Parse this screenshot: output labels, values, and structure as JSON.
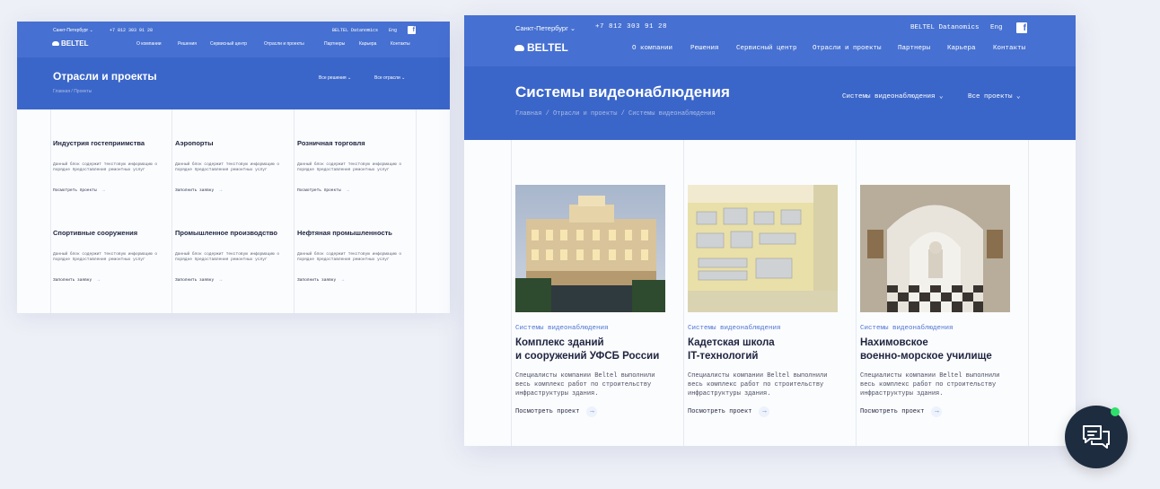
{
  "left_mockup": {
    "header": {
      "city": "Санкт-Петербург ⌄",
      "phone": "+7 812 303 91 28",
      "datanomics": "BELTEL Datanomics",
      "lang": "Eng",
      "fb_icon": "f",
      "logo": "BELTEL",
      "nav": [
        "О компании",
        "Решения",
        "Сервисный центр",
        "Отрасли и проекты",
        "Партнеры",
        "Карьера",
        "Контакты"
      ]
    },
    "hero": {
      "title": "Отрасли и проекты",
      "breadcrumb": "Главная / Проекты",
      "filter_solutions": "Все решения ⌄",
      "filter_industries": "Все отрасли ⌄"
    },
    "cards": [
      {
        "title": "Индустрия гостеприимства",
        "desc": "Данный блок содержит текстовую информацию о порядке предоставления ремонтных услуг",
        "link": "Посмотреть проекты"
      },
      {
        "title": "Аэропорты",
        "desc": "Данный блок содержит текстовую информацию о порядке предоставления ремонтных услуг",
        "link": "Заполнить заявку"
      },
      {
        "title": "Розничная торговля",
        "desc": "Данный блок содержит текстовую информацию о порядке предоставления ремонтных услуг",
        "link": "Посмотреть проекты"
      },
      {
        "title": "Спортивные сооружения",
        "desc": "Данный блок содержит текстовую информацию о порядке предоставления ремонтных услуг",
        "link": "Заполнить заявку"
      },
      {
        "title": "Промышленное производство",
        "desc": "Данный блок содержит текстовую информацию о порядке предоставления ремонтных услуг",
        "link": "Заполнить заявку"
      },
      {
        "title": "Нефтяная промышленность",
        "desc": "Данный блок содержит текстовую информацию о порядке предоставления ремонтных услуг",
        "link": "Заполнить заявку"
      }
    ]
  },
  "right_mockup": {
    "header": {
      "city": "Санкт-Петербург ⌄",
      "phone": "+7 812 303 91 28",
      "datanomics": "BELTEL Datanomics",
      "lang": "Eng",
      "fb_icon": "f",
      "logo": "BELTEL",
      "nav": [
        "О компании",
        "Решения",
        "Сервисный центр",
        "Отрасли и проекты",
        "Партнеры",
        "Карьера",
        "Контакты"
      ]
    },
    "hero": {
      "title": "Системы видеонаблюдения",
      "breadcrumb": "Главная  /  Отрасли и проекты  /  Системы видеонаблюдения",
      "filter_solution": "Системы видеонаблюдения ⌄",
      "filter_projects": "Все проекты ⌄"
    },
    "cards": [
      {
        "category": "Системы видеонаблюдения",
        "title_line1": "Комплекс зданий",
        "title_line2": "и сооружений УФСБ России",
        "desc": "Специалисты компании Beltel выполнили весь комплекс работ по строительству инфраструктуры здания.",
        "link": "Посмотреть проект"
      },
      {
        "category": "Системы видеонаблюдения",
        "title_line1": "Кадетская школа",
        "title_line2": "IT-технологий",
        "desc": "Специалисты компании Beltel выполнили весь комплекс работ по строительству инфраструктуры здания.",
        "link": "Посмотреть проект"
      },
      {
        "category": "Системы видеонаблюдения",
        "title_line1": "Нахимовское",
        "title_line2": "военно-морское училище",
        "desc": "Специалисты компании Beltel выполнили весь комплекс работ по строительству инфраструктуры здания.",
        "link": "Посмотреть проект"
      }
    ]
  },
  "arrow_glyph": "→",
  "chat": {
    "icon": "chat-bubbles-icon",
    "online_color": "#2ee06b"
  },
  "colors": {
    "brand_blue": "#3b66c9",
    "topbar_blue": "#4670d1",
    "text_dark": "#1f2440",
    "link_blue": "#4e74d3"
  }
}
